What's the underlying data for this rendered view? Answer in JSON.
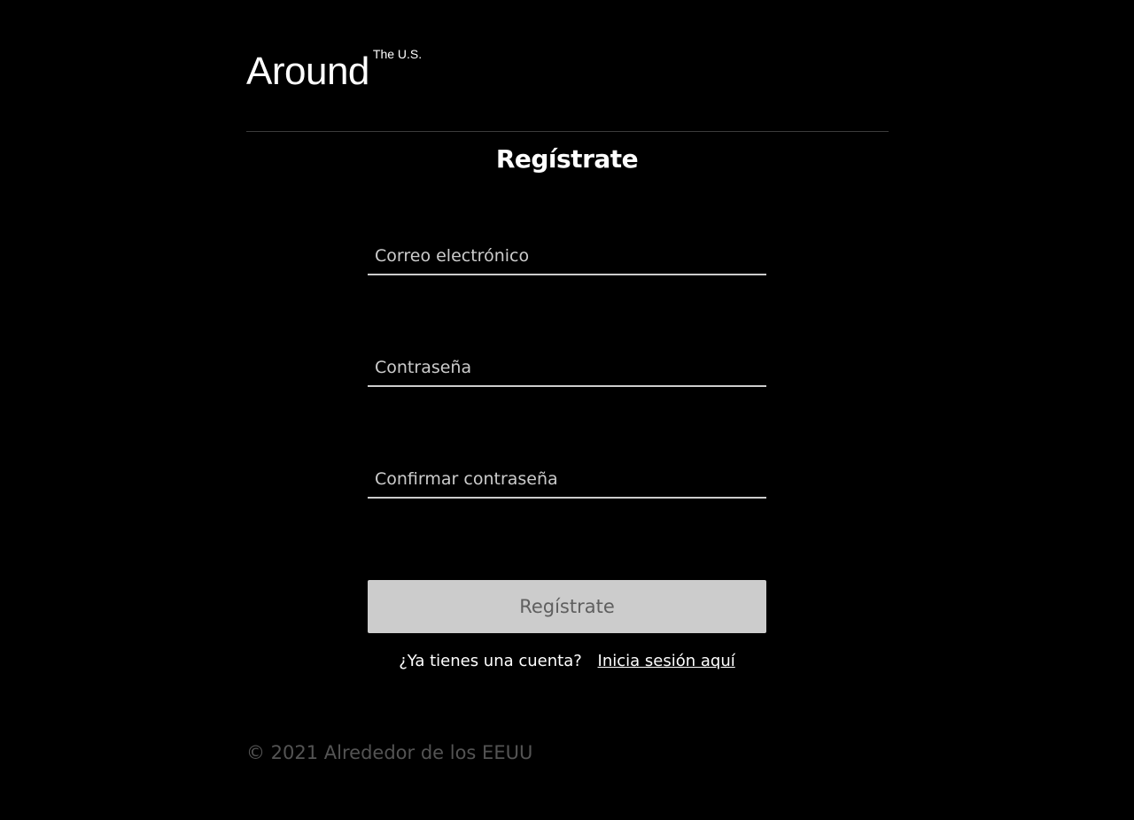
{
  "header": {
    "logo_main": "Around",
    "logo_sup": "The U.S."
  },
  "form": {
    "title": "Regístrate",
    "email": {
      "placeholder": "Correo electrónico",
      "value": ""
    },
    "password": {
      "placeholder": "Contraseña",
      "value": ""
    },
    "confirm_password": {
      "placeholder": "Confirmar contraseña",
      "value": ""
    },
    "submit_label": "Regístrate",
    "signin_prompt": "¿Ya tienes una cuenta?",
    "signin_link": "Inicia sesión aquí"
  },
  "footer": {
    "copyright": "© 2021 Alrededor de los EEUU"
  },
  "colors": {
    "background": "#000000",
    "text": "#ffffff",
    "field_underline": "#cccccc",
    "button_background": "#cccccc",
    "button_text": "#5f5f5f",
    "footer_text": "#545454"
  }
}
